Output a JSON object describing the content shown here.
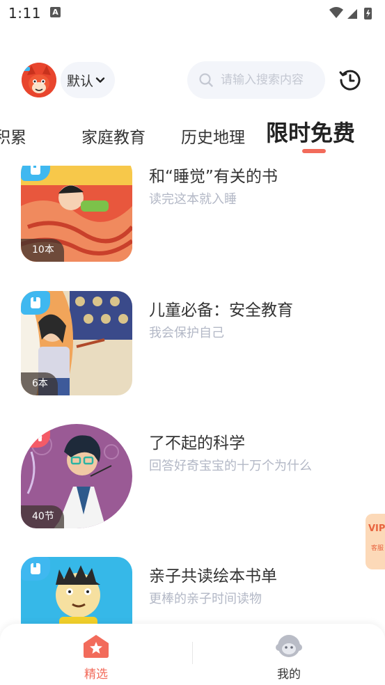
{
  "status_bar": {
    "time": "1:11",
    "notification_icon": "A"
  },
  "header": {
    "mode_label": "默认",
    "search_placeholder": "请输入搜索内容"
  },
  "tabs": {
    "items": [
      "积累",
      "家庭教育",
      "历史地理"
    ],
    "active": "限时免费"
  },
  "list": [
    {
      "title": "和“睡觉”有关的书",
      "subtitle": "读完这本就入睡",
      "count": "10本",
      "type": "book-icon"
    },
    {
      "title": "儿童必备：安全教育",
      "subtitle": "我会保护自己",
      "count": "6本",
      "type": "book-icon"
    },
    {
      "title": "了不起的科学",
      "subtitle": "回答好奇宝宝的十万个为什么",
      "count": "40节",
      "type": "headphones-icon"
    },
    {
      "title": "亲子共读绘本书单",
      "subtitle": "更棒的亲子时间读物",
      "count": "",
      "type": "book-icon"
    }
  ],
  "vip_float": {
    "label": "VIP",
    "sub": "客服"
  },
  "bottom_nav": {
    "home_label": "精选",
    "mine_label": "我的"
  },
  "colors": {
    "accent": "#f26b5b",
    "badge_blue": "#3fb8f0",
    "badge_red": "#f45b67",
    "muted_text": "#b3b8c6"
  }
}
